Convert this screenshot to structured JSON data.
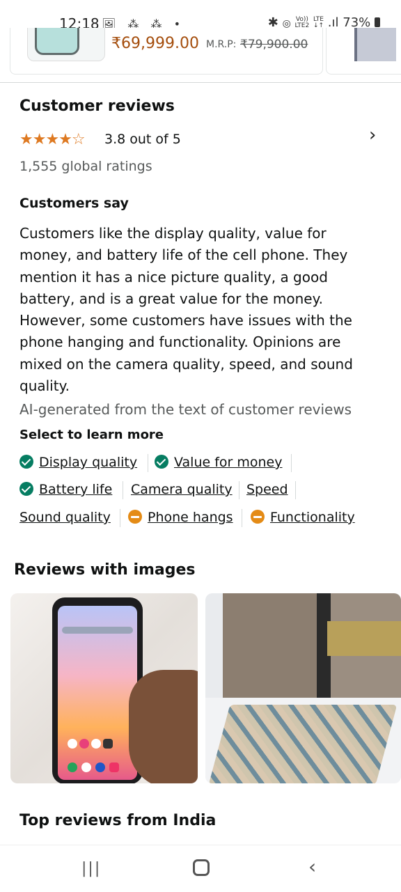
{
  "status_bar": {
    "time": "12:18",
    "left_icons": "🖼 ⁂ ⁂ •",
    "bluetooth": "✱",
    "volte_top": "Vo))",
    "volte_bottom": "LTE2",
    "lte_top": "LTE",
    "lte_bottom": "↓↑",
    "signal": ".ıl",
    "battery": "73%"
  },
  "product_strip": {
    "price": "₹69,999.00",
    "mrp_label": "M.R.P:",
    "mrp_value": "₹79,900.00"
  },
  "reviews": {
    "title": "Customer reviews",
    "stars": "★★★★☆",
    "rating_text": "3.8 out of 5",
    "global_ratings": "1,555 global ratings",
    "chevron": "›",
    "customers_say_title": "Customers say",
    "summary": "Customers like the display quality, value for money, and battery life of the cell phone. They mention it has a nice picture quality, a good battery, and is a great value for the money. However, some customers have issues with the phone hanging and functionality. Opinions are mixed on the camera quality, speed, and sound quality.",
    "ai_note": "AI-generated from the text of customer reviews",
    "learn_more": "Select to learn more",
    "aspects": [
      {
        "label": "Display quality",
        "sentiment": "positive"
      },
      {
        "label": "Value for money",
        "sentiment": "positive"
      },
      {
        "label": "Battery life",
        "sentiment": "positive"
      },
      {
        "label": "Camera quality",
        "sentiment": "mixed"
      },
      {
        "label": "Speed",
        "sentiment": "mixed"
      },
      {
        "label": "Sound quality",
        "sentiment": "mixed"
      },
      {
        "label": "Phone hangs",
        "sentiment": "negative"
      },
      {
        "label": "Functionality",
        "sentiment": "negative"
      }
    ]
  },
  "images_section": {
    "title": "Reviews with images"
  },
  "top_reviews": {
    "title": "Top reviews from India"
  },
  "nav": {
    "recents": "|||",
    "back": "‹"
  },
  "colors": {
    "star": "#de7921",
    "positive": "#067d62",
    "negative": "#e48b16",
    "price": "#a44d0c"
  }
}
